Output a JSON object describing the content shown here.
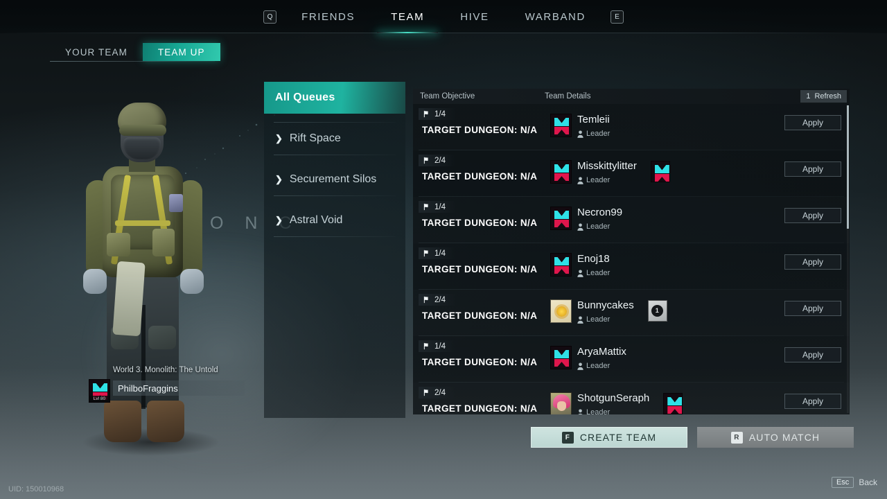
{
  "top_nav": {
    "left_key": "Q",
    "right_key": "E",
    "items": [
      {
        "label": "FRIENDS",
        "active": false
      },
      {
        "label": "TEAM",
        "active": true
      },
      {
        "label": "HIVE",
        "active": false
      },
      {
        "label": "WARBAND",
        "active": false
      }
    ]
  },
  "sub_tabs": [
    {
      "label": "YOUR TEAM",
      "active": false
    },
    {
      "label": "TEAM UP",
      "active": true
    }
  ],
  "queue_panel": {
    "items": [
      {
        "label": "All Queues",
        "active": true,
        "expandable": false
      },
      {
        "label": "Rift Space",
        "active": false,
        "expandable": true
      },
      {
        "label": "Securement Silos",
        "active": false,
        "expandable": true
      },
      {
        "label": "Astral Void",
        "active": false,
        "expandable": true
      }
    ]
  },
  "listing": {
    "header": {
      "objective_col": "Team Objective",
      "details_col": "Team Details",
      "refresh_count": "1",
      "refresh_label": "Refresh"
    },
    "rows": [
      {
        "count": "1/4",
        "objective": "TARGET DUNGEON: N/A",
        "leader_name": "Temleii",
        "leader_role": "Leader",
        "leader_avatar": "emblem-avatar",
        "extra_members": [],
        "apply_label": "Apply"
      },
      {
        "count": "2/4",
        "objective": "TARGET DUNGEON: N/A",
        "leader_name": "Misskittylitter",
        "leader_role": "Leader",
        "leader_avatar": "emblem-avatar",
        "extra_members": [
          "emblem-avatar"
        ],
        "apply_label": "Apply"
      },
      {
        "count": "1/4",
        "objective": "TARGET DUNGEON: N/A",
        "leader_name": "Necron99",
        "leader_role": "Leader",
        "leader_avatar": "emblem-avatar",
        "extra_members": [],
        "apply_label": "Apply"
      },
      {
        "count": "1/4",
        "objective": "TARGET DUNGEON: N/A",
        "leader_name": "Enoj18",
        "leader_role": "Leader",
        "leader_avatar": "emblem-avatar",
        "extra_members": [],
        "apply_label": "Apply"
      },
      {
        "count": "2/4",
        "objective": "TARGET DUNGEON: N/A",
        "leader_name": "Bunnycakes",
        "leader_role": "Leader",
        "leader_avatar": "sun-avatar",
        "extra_members": [
          "coin-avatar"
        ],
        "apply_label": "Apply"
      },
      {
        "count": "1/4",
        "objective": "TARGET DUNGEON: N/A",
        "leader_name": "AryaMattix",
        "leader_role": "Leader",
        "leader_avatar": "emblem-avatar",
        "extra_members": [],
        "apply_label": "Apply"
      },
      {
        "count": "2/4",
        "objective": "TARGET DUNGEON: N/A",
        "leader_name": "ShotgunSeraph",
        "leader_role": "Leader",
        "leader_avatar": "girl-avatar",
        "extra_members": [
          "emblem-avatar"
        ],
        "apply_label": "Apply"
      }
    ]
  },
  "player": {
    "world_label": "World 3. Monolith: The Untold",
    "name": "PhilboFraggins",
    "level_badge": "Lvl 80",
    "uid": "UID: 150010968"
  },
  "footer": {
    "create_team": {
      "key": "F",
      "label": "CREATE TEAM"
    },
    "auto_match": {
      "key": "R",
      "label": "AUTO MATCH"
    },
    "back": {
      "key": "Esc",
      "label": "Back"
    }
  },
  "background": {
    "decor_text": "O N C"
  },
  "colors": {
    "accent_teal": "#1fb3a0",
    "accent_glow": "#3fe3c6",
    "emblem_cyan": "#2fe0e6",
    "emblem_red": "#e0164c",
    "primary_button": "#cfe4e0"
  }
}
